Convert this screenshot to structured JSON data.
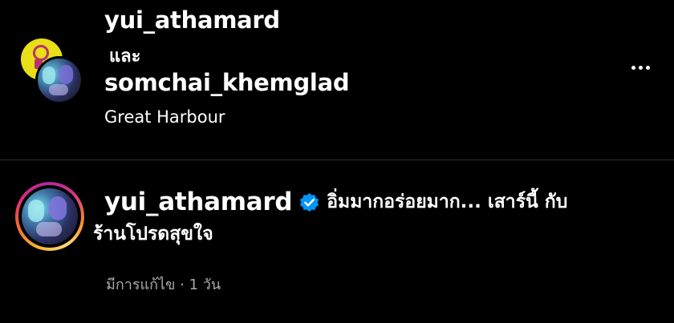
{
  "post_header": {
    "author_1": "yui_athamard",
    "conjunction": "และ",
    "author_2": "somchai_khemglad",
    "location": "Great Harbour",
    "more_icon": "more-horizontal-icon"
  },
  "caption": {
    "username": "yui_athamard",
    "verified_icon": "verified-badge-icon",
    "text_line_1": "อิ่มมากอร่อยมาก... เสาร์นี้ กับ",
    "text_line_2": "ร้านโปรดสุขใจ",
    "edited_label": "มีการแก้ไข",
    "separator": "·",
    "time_ago": "1 วัน"
  },
  "colors": {
    "background": "#000000",
    "text_primary": "#ffffff",
    "text_secondary": "#a8a8a8",
    "verified_blue": "#0095f6",
    "divider": "#2f2f2f"
  }
}
